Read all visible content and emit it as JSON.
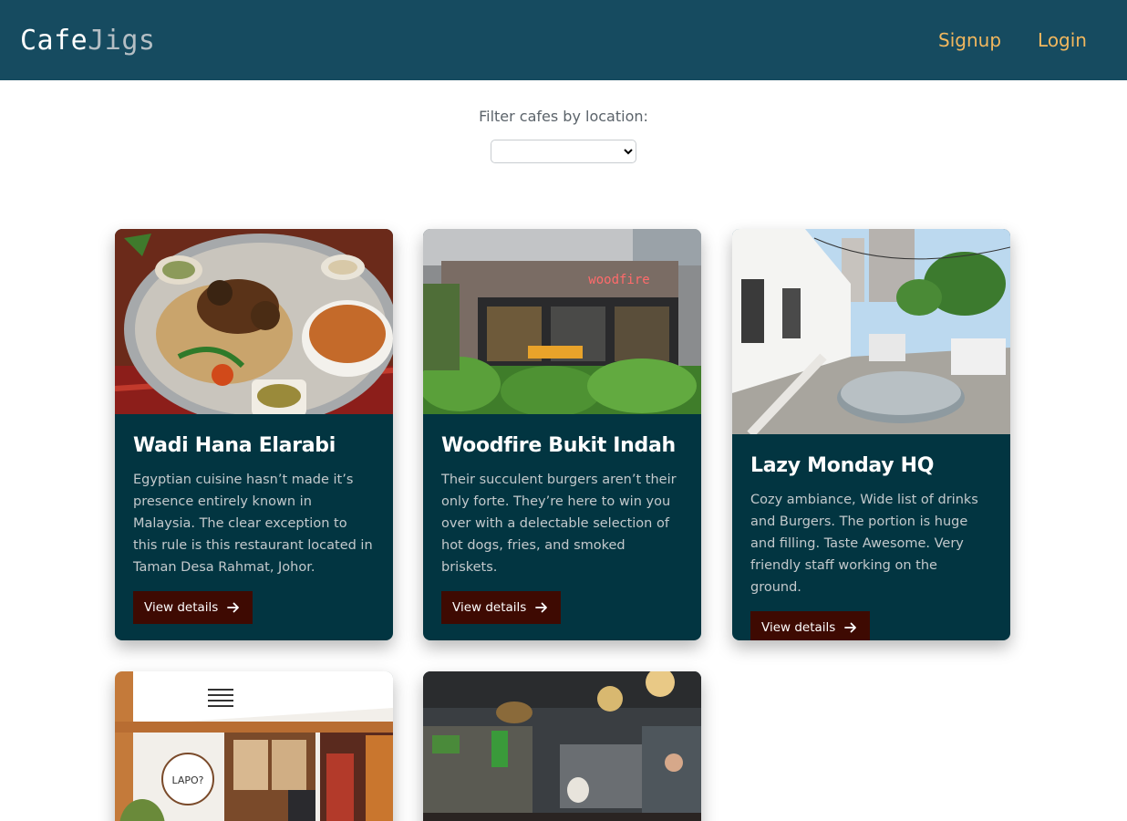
{
  "brand": {
    "part1": "Cafe",
    "part2": "Jigs"
  },
  "nav": {
    "signup": "Signup",
    "login": "Login"
  },
  "filter": {
    "label": "Filter cafes by location:",
    "selected": ""
  },
  "cards": [
    {
      "title": "Wadi Hana Elarabi",
      "description": "Egyptian cuisine hasn’t made it’s presence entirely known in Malaysia. The clear exception to this rule is this restaurant located in Taman Desa Rahmat, Johor.",
      "button": "View details",
      "image_icon": "food-platter-image"
    },
    {
      "title": "Woodfire Bukit Indah",
      "description": "Their succulent burgers aren’t their only forte. They’re here to win you over with a delectable selection of hot dogs, fries, and smoked briskets.",
      "button": "View details",
      "image_icon": "storefront-image",
      "sign_text": "woodfire"
    },
    {
      "title": "Lazy Monday HQ",
      "description": "Cozy ambiance, Wide list of drinks and Burgers. The portion is huge and filling. Taste Awesome. Very friendly staff working on the ground.",
      "button": "View details",
      "image_icon": "outdoor-seating-image"
    },
    {
      "image_icon": "cafe-entrance-image",
      "sign_text": "LAPO?"
    },
    {
      "image_icon": "cafe-interior-image"
    }
  ],
  "colors": {
    "navbar": "#164b60",
    "nav_link": "#f1b75e",
    "card_bg": "#023541",
    "button_bg": "#3e0a02"
  }
}
